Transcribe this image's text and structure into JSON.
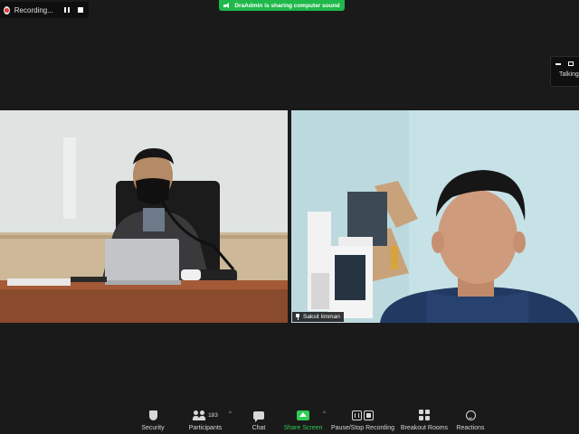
{
  "recording": {
    "label": "Recording...",
    "pause_icon": "pause-icon",
    "stop_icon": "stop-icon"
  },
  "share_banner": {
    "text": "DraAdmin is sharing computer sound",
    "icon": "speaker-icon",
    "color": "#1fb84a"
  },
  "talking_panel": {
    "label": "Talking"
  },
  "videos": [
    {
      "name": ""
    },
    {
      "name": "Saksit Iimman",
      "pinned": true
    }
  ],
  "toolbar": {
    "security": "Security",
    "participants": "Participants",
    "participant_count": "183",
    "chat": "Chat",
    "share_screen": "Share Screen",
    "record": "Pause/Stop Recording",
    "breakout": "Breakout Rooms",
    "reactions": "Reactions",
    "accent": "#2ecc55"
  }
}
